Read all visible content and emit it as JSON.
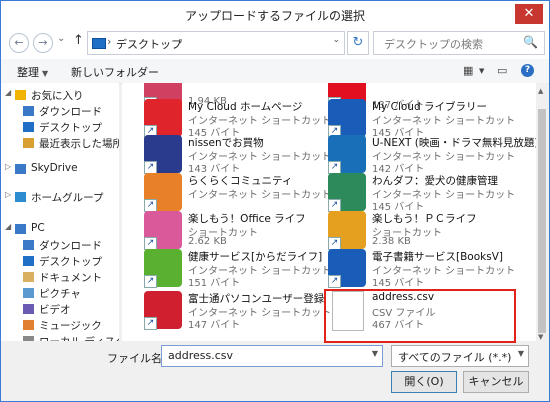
{
  "window": {
    "title": "アップロードするファイルの選択",
    "close_glyph": "✕"
  },
  "nav": {
    "back_glyph": "←",
    "forward_glyph": "→",
    "dropdown_glyph": "⌄",
    "up_glyph": "↑",
    "address_path": "デスクトップ",
    "address_sep": "›",
    "refresh_glyph": "↻",
    "search_placeholder": "デスクトップの検索",
    "search_glyph": "🔍"
  },
  "toolbar": {
    "organize_label": "整理",
    "new_folder_label": "新しいフォルダー",
    "dd_glyph": "▼",
    "view_glyph": "▦",
    "preview_glyph": "▭",
    "help_glyph": "?"
  },
  "sidebar": {
    "items": [
      {
        "label": "お気に入り",
        "arrow": "◢",
        "icon_color": "#f0b400"
      },
      {
        "label": "ダウンロード",
        "icon_color": "#3a78c8"
      },
      {
        "label": "デスクトップ",
        "icon_color": "#1f6fc7"
      },
      {
        "label": "最近表示した場所",
        "icon_color": "#d8a030"
      },
      {
        "label": "SkyDrive",
        "arrow": "▷",
        "icon_color": "#3a78c8"
      },
      {
        "label": "ホームグループ",
        "arrow": "▷",
        "icon_color": "#2d8bd0"
      },
      {
        "label": "PC",
        "arrow": "◢",
        "icon_color": "#3a78c8"
      },
      {
        "label": "ダウンロード",
        "icon_color": "#3a78c8"
      },
      {
        "label": "デスクトップ",
        "icon_color": "#1f6fc7"
      },
      {
        "label": "ドキュメント",
        "icon_color": "#d8b060"
      },
      {
        "label": "ピクチャ",
        "icon_color": "#5a9ad0"
      },
      {
        "label": "ビデオ",
        "icon_color": "#6a5ab0"
      },
      {
        "label": "ミュージック",
        "icon_color": "#e08030"
      },
      {
        "label": "ローカル ディスク (C",
        "icon_color": "#888888"
      }
    ]
  },
  "files": [
    {
      "name": "",
      "type": "",
      "size": "1.94 KB",
      "color": "#d04060"
    },
    {
      "name": "",
      "type": "",
      "size": "137 バイト",
      "color": "#e01020"
    },
    {
      "name": "My Cloud ホームページ",
      "type": "インターネット ショートカット",
      "size": "145 バイト",
      "color": "#e0242c"
    },
    {
      "name": "My Cloud ライブラリー",
      "type": "インターネット ショートカット",
      "size": "145 バイト",
      "color": "#1a5db8"
    },
    {
      "name": "nissenでお買物",
      "type": "インターネット ショートカット",
      "size": "143 バイト",
      "color": "#2a3a8c"
    },
    {
      "name": "U-NEXT (映画・ドラマ無料見放題)",
      "type": "インターネット ショートカット",
      "size": "142 バイト",
      "color": "#1a70b8"
    },
    {
      "name": "らくらくコミュニティ",
      "type": "インターネット ショートカット",
      "size": "",
      "color": "#e8802a"
    },
    {
      "name": "わんダフ：愛犬の健康管理",
      "type": "インターネット ショートカット",
      "size": "145 バイト",
      "color": "#2d8a5a"
    },
    {
      "name": "楽しもう！Office ライフ",
      "type": "ショートカット",
      "size": "2.62 KB",
      "color": "#d85a9a"
    },
    {
      "name": "楽しもう！ＰＣライフ",
      "type": "ショートカット",
      "size": "2.38 KB",
      "color": "#e6a020"
    },
    {
      "name": "健康サービス[からだライフ]",
      "type": "インターネット ショートカット",
      "size": "151 バイト",
      "color": "#5ab030"
    },
    {
      "name": "電子書籍サービス[BooksV]",
      "type": "インターネット ショートカット",
      "size": "145 バイト",
      "color": "#1a5db8"
    },
    {
      "name": "富士通パソコンユーザー登録",
      "type": "インターネット ショートカット",
      "size": "147 バイト",
      "color": "#d02030"
    },
    {
      "name": "address.csv",
      "type": "CSV ファイル",
      "size": "467 バイト",
      "color": "#ffffff"
    }
  ],
  "bottom": {
    "filename_label": "ファイル名(N):",
    "filename_value": "address.csv",
    "filetype_value": "すべてのファイル (*.*)",
    "open_label": "開く(O)",
    "cancel_label": "キャンセル",
    "dd_glyph": "▼",
    "scroll_up_glyph": "▲",
    "scroll_down_glyph": "▼"
  }
}
